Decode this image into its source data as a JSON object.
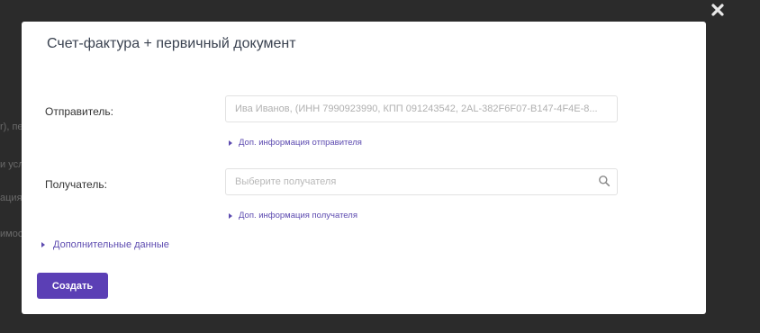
{
  "backdrop": {
    "fragments": [
      "r), пе",
      "и усл",
      "ация",
      "имос"
    ]
  },
  "modal": {
    "title": "Счет-фактура + первичный документ",
    "sender": {
      "label": "Отправитель:",
      "value": "Ива Иванов, (ИНН 7990923990, КПП 091243542, 2AL-382F6F07-B147-4F4E-8...",
      "info_link": "Доп. информация отправителя"
    },
    "recipient": {
      "label": "Получатель:",
      "placeholder": "Выберите получателя",
      "info_link": "Доп. информация получателя"
    },
    "extra_link": "Дополнительные данные",
    "create_label": "Создать"
  },
  "colors": {
    "overlay": "#2b2b2b",
    "accent": "#5b3fb5",
    "link": "#5d4bb0"
  },
  "icons": {
    "close": "close-icon",
    "search": "search-icon",
    "caret": "caret-right-icon"
  }
}
